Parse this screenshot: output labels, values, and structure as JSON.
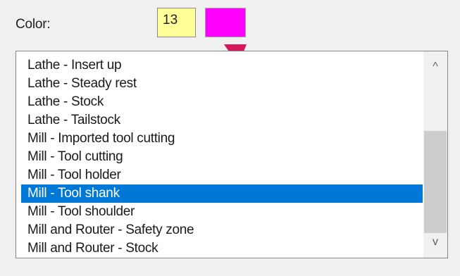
{
  "color_setting": {
    "label": "Color:",
    "index_value": "13",
    "swatch_color": "#ff00ff",
    "index_field_color": "#ffff99"
  },
  "annotation": {
    "arrow_color": "#d6165c",
    "arrow_icon": "arrow-icon"
  },
  "list": {
    "items": [
      "Lathe - Insert up",
      "Lathe - Steady rest",
      "Lathe - Stock",
      "Lathe - Tailstock",
      "Mill - Imported tool cutting",
      "Mill - Tool cutting",
      "Mill - Tool holder",
      "Mill - Tool shank",
      "Mill - Tool shoulder",
      "Mill and Router - Safety zone",
      "Mill and Router - Stock"
    ],
    "selected_item": "Mill - Tool shank",
    "selection_color": "#0078d7"
  },
  "scrollbar": {
    "up_icon": "chevron-up-icon",
    "up_glyph": "^",
    "down_icon": "chevron-down-icon",
    "down_glyph": "v"
  }
}
